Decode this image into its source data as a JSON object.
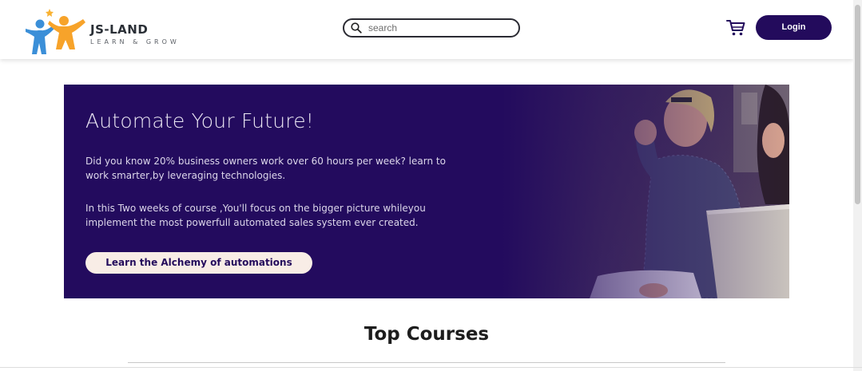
{
  "header": {
    "logo": {
      "title": "JS-LAND",
      "tagline": "LEARN & GROW",
      "colors": {
        "star": "#f9b233",
        "figure_blue": "#3b8fd8",
        "figure_orange": "#f7a32a"
      }
    },
    "search": {
      "placeholder": "search",
      "icon": "search-icon"
    },
    "cart": {
      "icon": "cart-icon"
    },
    "login_label": "Login",
    "accent": "#230b5c"
  },
  "hero": {
    "title": "Automate Your Future!",
    "paragraph1": "Did you know 20% business owners work over 60 hours per week? learn to work smarter,by leveraging technologies.",
    "paragraph2": "In this Two weeks of course ,You'll focus on the bigger picture whileyou implement the most powerfull automated sales system ever created.",
    "cta_label": "Learn the Alchemy of automations",
    "background": "#230b5e",
    "cta_background": "#f8ede6"
  },
  "section": {
    "title": "Top Courses"
  }
}
